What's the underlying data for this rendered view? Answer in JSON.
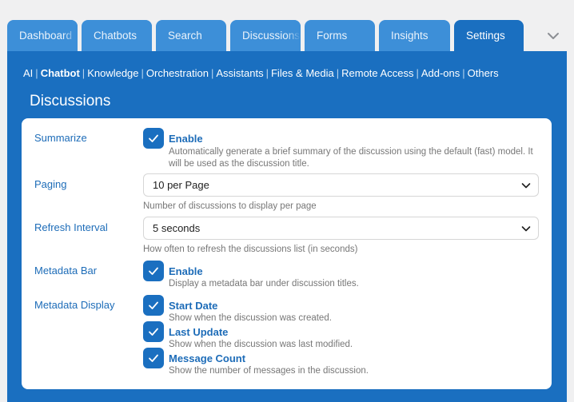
{
  "tabs": [
    {
      "label": "Dashboard",
      "active": false
    },
    {
      "label": "Chatbots",
      "active": false
    },
    {
      "label": "Search",
      "active": false
    },
    {
      "label": "Discussions",
      "active": false
    },
    {
      "label": "Forms",
      "active": false
    },
    {
      "label": "Insights",
      "active": false
    },
    {
      "label": "Settings",
      "active": true
    }
  ],
  "subnav": {
    "items": [
      "AI",
      "Chatbot",
      "Knowledge",
      "Orchestration",
      "Assistants",
      "Files & Media",
      "Remote Access",
      "Add-ons",
      "Others"
    ],
    "active": "Chatbot",
    "separator": "|"
  },
  "section_title": "Discussions",
  "settings": {
    "summarize": {
      "label": "Summarize",
      "checkbox_label": "Enable",
      "checked": true,
      "description": "Automatically generate a brief summary of the discussion using the default (fast) model. It will be used as the discussion title."
    },
    "paging": {
      "label": "Paging",
      "value": "10 per Page",
      "description": "Number of discussions to display per page"
    },
    "refresh": {
      "label": "Refresh Interval",
      "value": "5 seconds",
      "description": "How often to refresh the discussions list (in seconds)"
    },
    "metadata_bar": {
      "label": "Metadata Bar",
      "checkbox_label": "Enable",
      "checked": true,
      "description": "Display a metadata bar under discussion titles."
    },
    "metadata_display": {
      "label": "Metadata Display",
      "options": [
        {
          "label": "Start Date",
          "checked": true,
          "description": "Show when the discussion was created."
        },
        {
          "label": "Last Update",
          "checked": true,
          "description": "Show when the discussion was last modified."
        },
        {
          "label": "Message Count",
          "checked": true,
          "description": "Show the number of messages in the discussion."
        }
      ]
    }
  },
  "colors": {
    "panel": "#1a6fc0",
    "tab": "#3d8fd8",
    "label": "#1d6cb8",
    "description": "#777777"
  },
  "icons": {
    "tabs_more": "chevron-down-icon",
    "checkbox": "check-icon",
    "select_arrow": "chevron-down-icon"
  }
}
